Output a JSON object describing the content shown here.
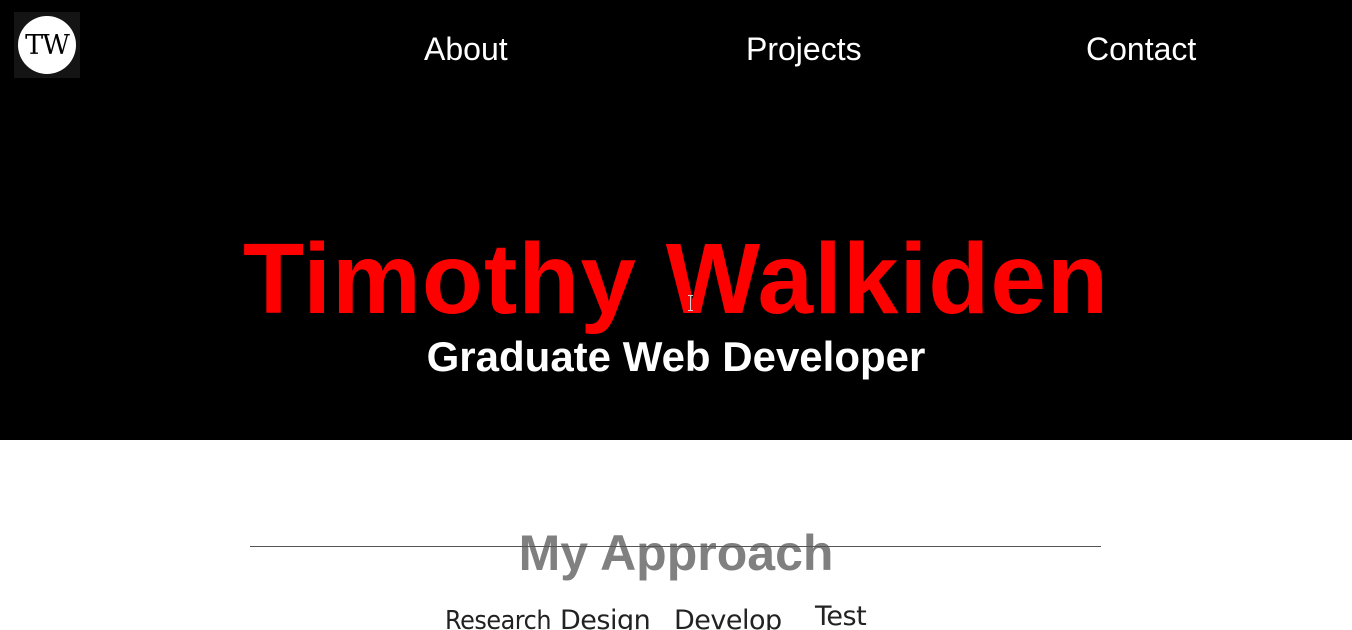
{
  "header": {
    "logo_text": "TW",
    "nav": [
      {
        "label": "About"
      },
      {
        "label": "Projects"
      },
      {
        "label": "Contact"
      }
    ]
  },
  "hero": {
    "name": "Timothy Walkiden",
    "subtitle": "Graduate Web Developer"
  },
  "approach": {
    "title": "My Approach",
    "steps": [
      "Research",
      "Design",
      "Develop",
      "Test"
    ]
  },
  "colors": {
    "hero_background": "#000000",
    "name_color": "#ff0000",
    "subtitle_color": "#ffffff",
    "section_title_color": "#808080"
  }
}
